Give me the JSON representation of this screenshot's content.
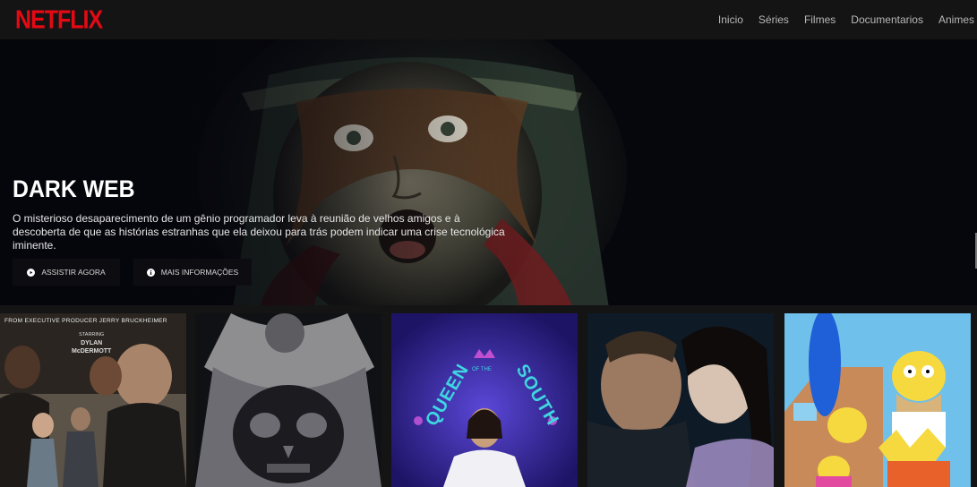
{
  "app": {
    "logo": "NETFLIX",
    "brand_color": "#e50914"
  },
  "nav": {
    "items": [
      "Inicio",
      "Séries",
      "Filmes",
      "Documentarios",
      "Animes"
    ]
  },
  "hero": {
    "title": "DARK WEB",
    "description": "O misterioso desaparecimento de um gênio programador leva à reunião de velhos amigos e à descoberta de que as histórias estranhas que ela deixou para trás podem indicar uma crise tecnológica iminente.",
    "play_label": "ASSISTIR AGORA",
    "info_label": "MAIS INFORMAÇÕES",
    "play_icon": "play-icon",
    "info_icon": "info-icon"
  },
  "posters": {
    "items": [
      {
        "name": "poster-1",
        "tagline": "FROM EXECUTIVE PRODUCER JERRY BRUCKHEIMER",
        "starring": "STARRING",
        "actor1": "DYLAN",
        "actor2": "McDERMOTT"
      },
      {
        "name": "poster-2"
      },
      {
        "name": "poster-3",
        "title_top": "QUEEN",
        "title_mid": "OF THE",
        "title_bottom": "SOUTH"
      },
      {
        "name": "poster-4"
      },
      {
        "name": "poster-5"
      }
    ]
  }
}
